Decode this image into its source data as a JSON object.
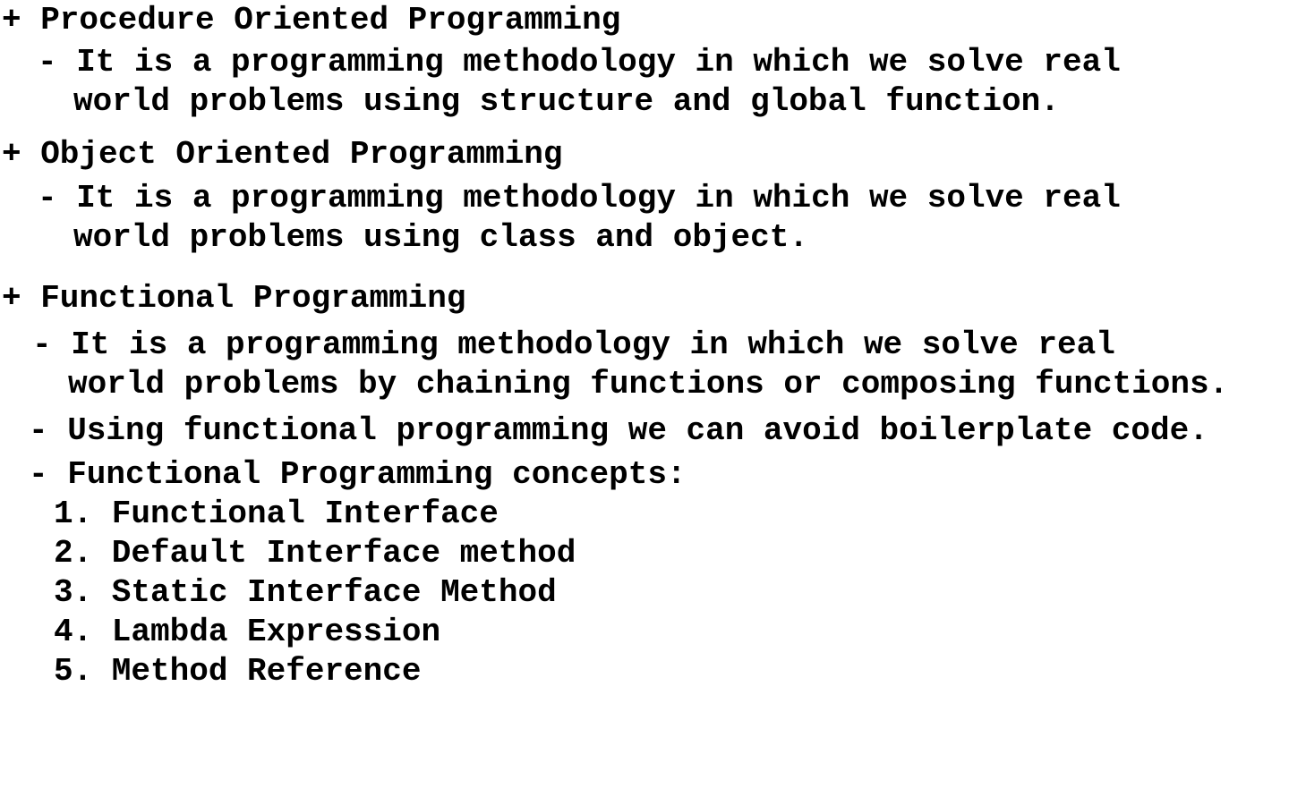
{
  "sections": [
    {
      "heading": "+ Procedure Oriented Programming",
      "bullets": [
        {
          "line1": "- It is a programming methodology in which we solve real",
          "line2": "world problems using structure and global function."
        }
      ]
    },
    {
      "heading": "+ Object Oriented Programming",
      "bullets": [
        {
          "line1": "- It is a programming methodology in which we solve real",
          "line2": "world problems using class and object."
        }
      ]
    },
    {
      "heading": "+ Functional Programming",
      "bullets": [
        {
          "line1": "- It is a programming methodology in which we solve real",
          "line2": "world problems by chaining functions or composing functions."
        },
        {
          "line1": "- Using functional programming we can avoid boilerplate code."
        },
        {
          "line1": "- Functional Programming concepts:"
        }
      ],
      "concepts": [
        "1. Functional Interface",
        "2. Default Interface method",
        "3. Static Interface Method",
        "4. Lambda Expression",
        "5. Method Reference"
      ]
    }
  ]
}
